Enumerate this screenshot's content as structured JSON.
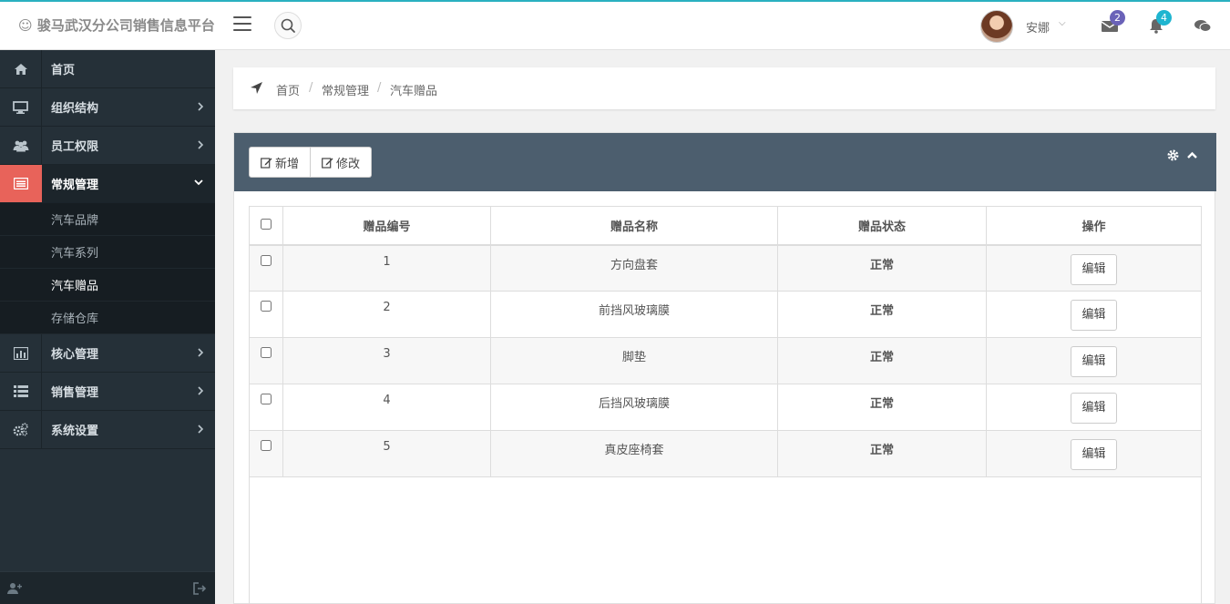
{
  "header": {
    "brand": "☺ 骏马武汉分公司销售信息平台",
    "user_name": "安娜",
    "mail_count": "2",
    "notification_count": "4",
    "colors": {
      "mail_badge": "#6a62b8",
      "notification_badge": "#1fb5d0",
      "accent": "#2ab0c0"
    }
  },
  "sidebar": {
    "items": [
      {
        "label": "首页",
        "icon": "home-icon"
      },
      {
        "label": "组织结构",
        "icon": "desktop-icon"
      },
      {
        "label": "员工权限",
        "icon": "users-icon"
      },
      {
        "label": "常规管理",
        "icon": "list-alt-icon"
      },
      {
        "label": "核心管理",
        "icon": "bar-chart-icon"
      },
      {
        "label": "销售管理",
        "icon": "list-icon"
      },
      {
        "label": "系统设置",
        "icon": "cogs-icon"
      }
    ],
    "sub_items": [
      "汽车品牌",
      "汽车系列",
      "汽车赠品",
      "存储仓库"
    ]
  },
  "breadcrumb": {
    "home": "首页",
    "level1": "常规管理",
    "current": "汽车赠品",
    "sep": "/"
  },
  "toolbar": {
    "add_label": "新增",
    "modify_label": "修改"
  },
  "table": {
    "headers": {
      "id": "赠品编号",
      "name": "赠品名称",
      "status": "赠品状态",
      "action": "操作"
    },
    "rows": [
      {
        "id": "1",
        "name": "方向盘套",
        "status": "正常",
        "action": "编辑"
      },
      {
        "id": "2",
        "name": "前挡风玻璃膜",
        "status": "正常",
        "action": "编辑"
      },
      {
        "id": "3",
        "name": "脚垫",
        "status": "正常",
        "action": "编辑"
      },
      {
        "id": "4",
        "name": "后挡风玻璃膜",
        "status": "正常",
        "action": "编辑"
      },
      {
        "id": "5",
        "name": "真皮座椅套",
        "status": "正常",
        "action": "编辑"
      }
    ]
  }
}
